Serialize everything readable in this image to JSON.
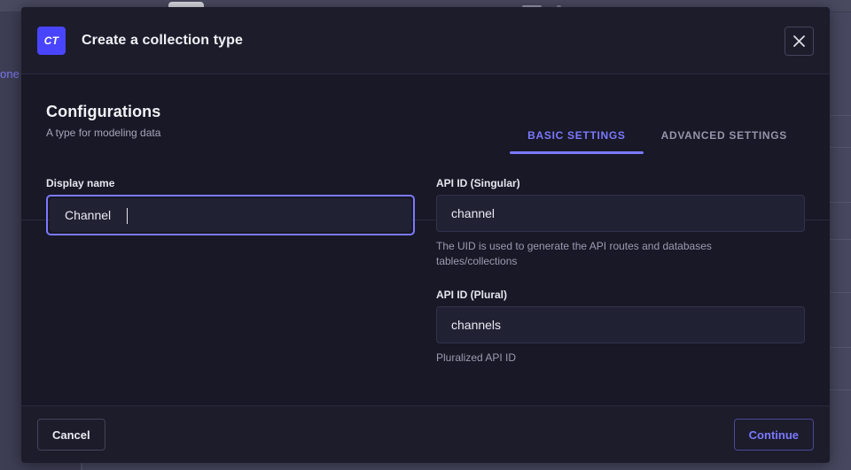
{
  "background": {
    "sidebar_link_text": "one",
    "row_dividers_y": [
      130,
      166,
      228,
      270,
      330,
      392,
      440
    ],
    "colors": {
      "page": "#42435a",
      "panel": "#474860",
      "divider": "#55566f"
    }
  },
  "modal": {
    "header": {
      "badge_text": "CT",
      "badge_color": "#4945ff",
      "title": "Create a collection type",
      "close_icon": "close-icon"
    },
    "section": {
      "title": "Configurations",
      "subtitle": "A type for modeling data"
    },
    "tabs": [
      {
        "label": "BASIC SETTINGS",
        "active": true
      },
      {
        "label": "ADVANCED SETTINGS",
        "active": false
      }
    ],
    "fields": {
      "display_name": {
        "label": "Display name",
        "value": "Channel",
        "placeholder": "",
        "focused": true
      },
      "api_id_singular": {
        "label": "API ID (Singular)",
        "value": "channel",
        "placeholder": "",
        "hint": "The UID is used to generate the API routes and databases tables/collections"
      },
      "api_id_plural": {
        "label": "API ID (Plural)",
        "value": "channels",
        "placeholder": "",
        "hint": "Pluralized API ID"
      }
    },
    "footer": {
      "cancel_label": "Cancel",
      "continue_label": "Continue"
    },
    "colors": {
      "accent": "#7b79ff",
      "surface": "#181826",
      "surface_alt": "#1c1c2b",
      "input_bg": "#212134",
      "border": "#32324d"
    }
  }
}
